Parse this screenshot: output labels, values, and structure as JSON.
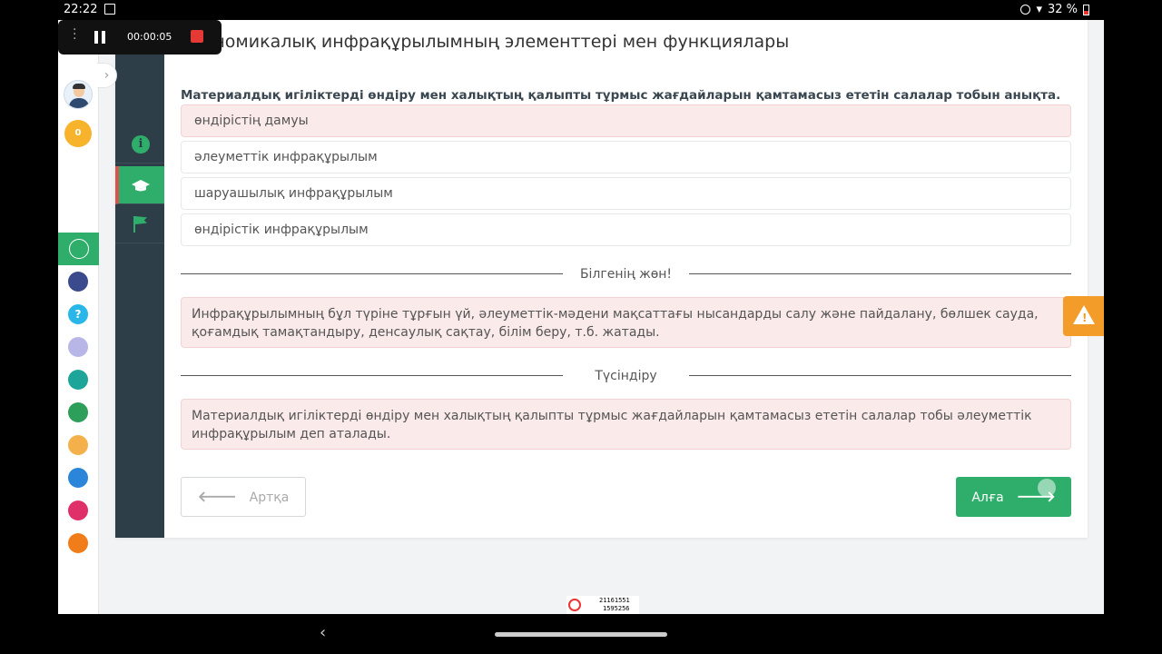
{
  "status_bar": {
    "time": "22:22",
    "battery": "32 %"
  },
  "recorder": {
    "elapsed": "00:00:05"
  },
  "sidebar": {
    "coins": "0"
  },
  "module": {
    "title": "Экономикалық инфрақұрылымның элементтері мен функциялары",
    "question": "Материалдық игіліктерді өндіру мен халықтың қалыпты тұрмыс жағдайларын қамтамасыз ететін салалар тобын анықта.",
    "options": [
      {
        "label": "өндірістің дамуы",
        "state": "wrong"
      },
      {
        "label": "әлеуметтік инфрақұрылым",
        "state": "neutral"
      },
      {
        "label": "шаруашылық инфрақұрылым",
        "state": "neutral"
      },
      {
        "label": "өндірістік инфрақұрылым",
        "state": "neutral"
      }
    ],
    "hint_heading": "Білгенің жөн!",
    "hint_text": "Инфрақұрылымның бұл түріне тұрғын үй, әлеуметтік-мәдени мақсаттағы нысандарды салу және пайдалану, бөлшек сауда, қоғамдық тамақтандыру, денсаулық сақтау, білім беру, т.б. жатады.",
    "explanation_heading": "Түсіндіру",
    "explanation_text": "Материалдық игіліктерді өндіру мен халықтың қалыпты тұрмыс жағдайларын қамтамасыз ететін салалар тобы әлеуметтік инфрақұрылым деп аталады.",
    "back_label": "Артқа",
    "next_label": "Алға"
  },
  "widget": {
    "line1": "21161551",
    "line2": "1595256"
  },
  "colors": {
    "accent": "#2fae6b",
    "wrong_bg": "#fbeaea",
    "sidebar_dark": "#2e3e48",
    "warning": "#f39c2a"
  }
}
